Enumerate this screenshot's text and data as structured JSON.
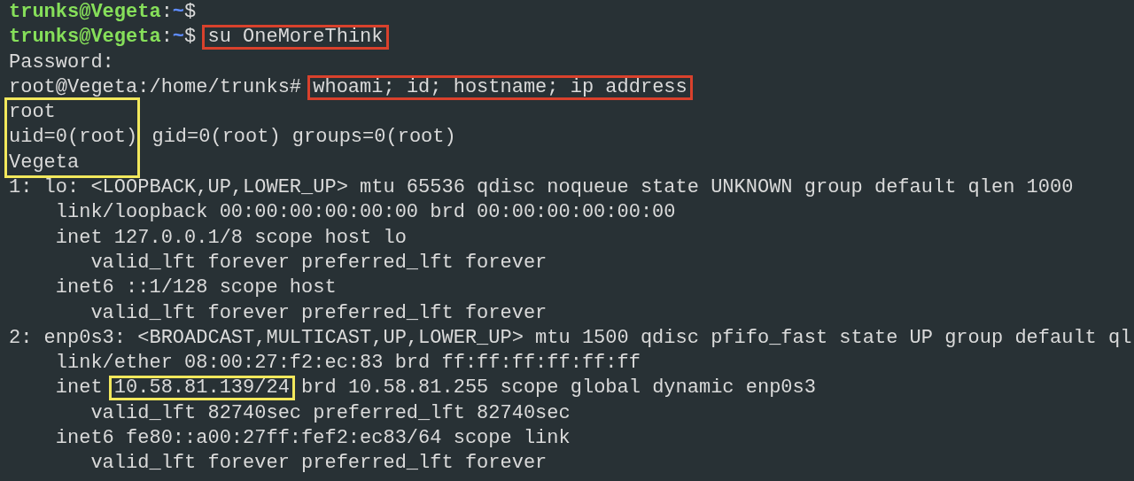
{
  "terminal": {
    "lines": [
      {
        "kind": "line",
        "segments": [
          {
            "kind": "user",
            "text": "trunks@Vegeta"
          },
          {
            "kind": "plain",
            "text": ":"
          },
          {
            "kind": "path",
            "text": "~"
          },
          {
            "kind": "plain",
            "text": "$"
          }
        ]
      },
      {
        "kind": "line",
        "segments": [
          {
            "kind": "user",
            "text": "trunks@Vegeta"
          },
          {
            "kind": "plain",
            "text": ":"
          },
          {
            "kind": "path",
            "text": "~"
          },
          {
            "kind": "plain",
            "text": "$ "
          },
          {
            "kind": "boxed",
            "text": "su OneMoreThink",
            "color": "#d9412c"
          }
        ]
      },
      {
        "kind": "line",
        "segments": [
          {
            "kind": "plain",
            "text": "Password:"
          }
        ]
      },
      {
        "kind": "line",
        "segments": [
          {
            "kind": "plain",
            "text": "root@Vegeta:/home/trunks# "
          },
          {
            "kind": "boxed",
            "text": "whoami; id; hostname; ip address",
            "color": "#d9412c"
          }
        ]
      },
      {
        "kind": "boxed_block",
        "color": "#f2e85c",
        "rows": [
          {
            "inside": "root"
          },
          {
            "inside": "uid=0(root)",
            "after": " gid=0(root) groups=0(root)"
          },
          {
            "inside": "Vegeta"
          }
        ]
      },
      {
        "kind": "line",
        "segments": [
          {
            "kind": "plain",
            "text": "1: lo: <LOOPBACK,UP,LOWER_UP> mtu 65536 qdisc noqueue state UNKNOWN group default qlen 1000"
          }
        ]
      },
      {
        "kind": "line",
        "segments": [
          {
            "kind": "plain",
            "text": "    link/loopback 00:00:00:00:00:00 brd 00:00:00:00:00:00"
          }
        ]
      },
      {
        "kind": "line",
        "segments": [
          {
            "kind": "plain",
            "text": "    inet 127.0.0.1/8 scope host lo"
          }
        ]
      },
      {
        "kind": "line",
        "segments": [
          {
            "kind": "plain",
            "text": "       valid_lft forever preferred_lft forever"
          }
        ]
      },
      {
        "kind": "line",
        "segments": [
          {
            "kind": "plain",
            "text": "    inet6 ::1/128 scope host"
          }
        ]
      },
      {
        "kind": "line",
        "segments": [
          {
            "kind": "plain",
            "text": "       valid_lft forever preferred_lft forever"
          }
        ]
      },
      {
        "kind": "line",
        "segments": [
          {
            "kind": "plain",
            "text": "2: enp0s3: <BROADCAST,MULTICAST,UP,LOWER_UP> mtu 1500 qdisc pfifo_fast state UP group default ql"
          }
        ]
      },
      {
        "kind": "line",
        "segments": [
          {
            "kind": "plain",
            "text": "    link/ether 08:00:27:f2:ec:83 brd ff:ff:ff:ff:ff:ff"
          }
        ]
      },
      {
        "kind": "line",
        "segments": [
          {
            "kind": "plain",
            "text": "    inet "
          },
          {
            "kind": "boxed",
            "text": "10.58.81.139/24",
            "color": "#f2e85c"
          },
          {
            "kind": "plain",
            "text": " brd 10.58.81.255 scope global dynamic enp0s3"
          }
        ]
      },
      {
        "kind": "line",
        "segments": [
          {
            "kind": "plain",
            "text": "       valid_lft 82740sec preferred_lft 82740sec"
          }
        ]
      },
      {
        "kind": "line",
        "segments": [
          {
            "kind": "plain",
            "text": "    inet6 fe80::a00:27ff:fef2:ec83/64 scope link"
          }
        ]
      },
      {
        "kind": "line",
        "segments": [
          {
            "kind": "plain",
            "text": "       valid_lft forever preferred_lft forever"
          }
        ]
      }
    ]
  }
}
